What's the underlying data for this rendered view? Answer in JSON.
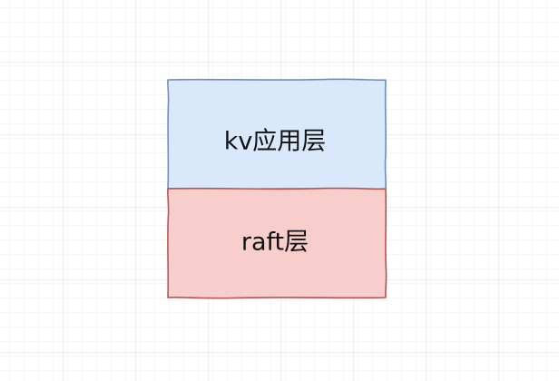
{
  "diagram": {
    "layers": [
      {
        "label": "kv应用层",
        "fill": "#dae8fc",
        "stroke": "#6c8ebf"
      },
      {
        "label": "raft层",
        "fill": "#f8cecc",
        "stroke": "#b85450"
      }
    ],
    "grid": {
      "visible": true,
      "minor_color": "#efefef",
      "major_color": "#dedede"
    }
  }
}
